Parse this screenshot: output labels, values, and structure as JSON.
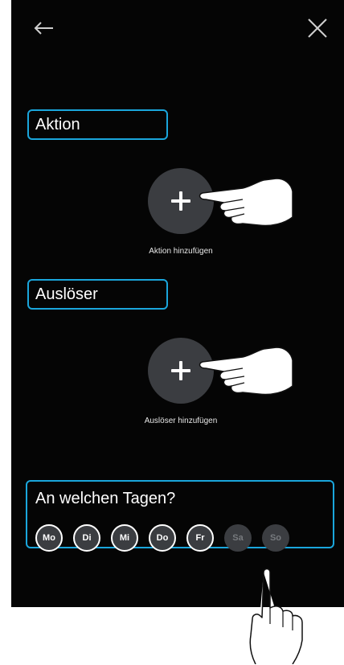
{
  "header": {
    "back_icon": "arrow-left-icon",
    "close_icon": "close-icon"
  },
  "action_section": {
    "label": "Aktion",
    "add_caption": "Aktion hinzufügen"
  },
  "trigger_section": {
    "label": "Auslöser",
    "add_caption": "Auslöser hinzufügen"
  },
  "days": {
    "title": "An welchen Tagen?",
    "items": [
      {
        "label": "Mo",
        "selected": true
      },
      {
        "label": "Di",
        "selected": true
      },
      {
        "label": "Mi",
        "selected": true
      },
      {
        "label": "Do",
        "selected": true
      },
      {
        "label": "Fr",
        "selected": true
      },
      {
        "label": "Sa",
        "selected": false
      },
      {
        "label": "So",
        "selected": false
      }
    ]
  },
  "colors": {
    "accent": "#1aa6dc",
    "background": "#050505",
    "button": "#3b3d41"
  }
}
